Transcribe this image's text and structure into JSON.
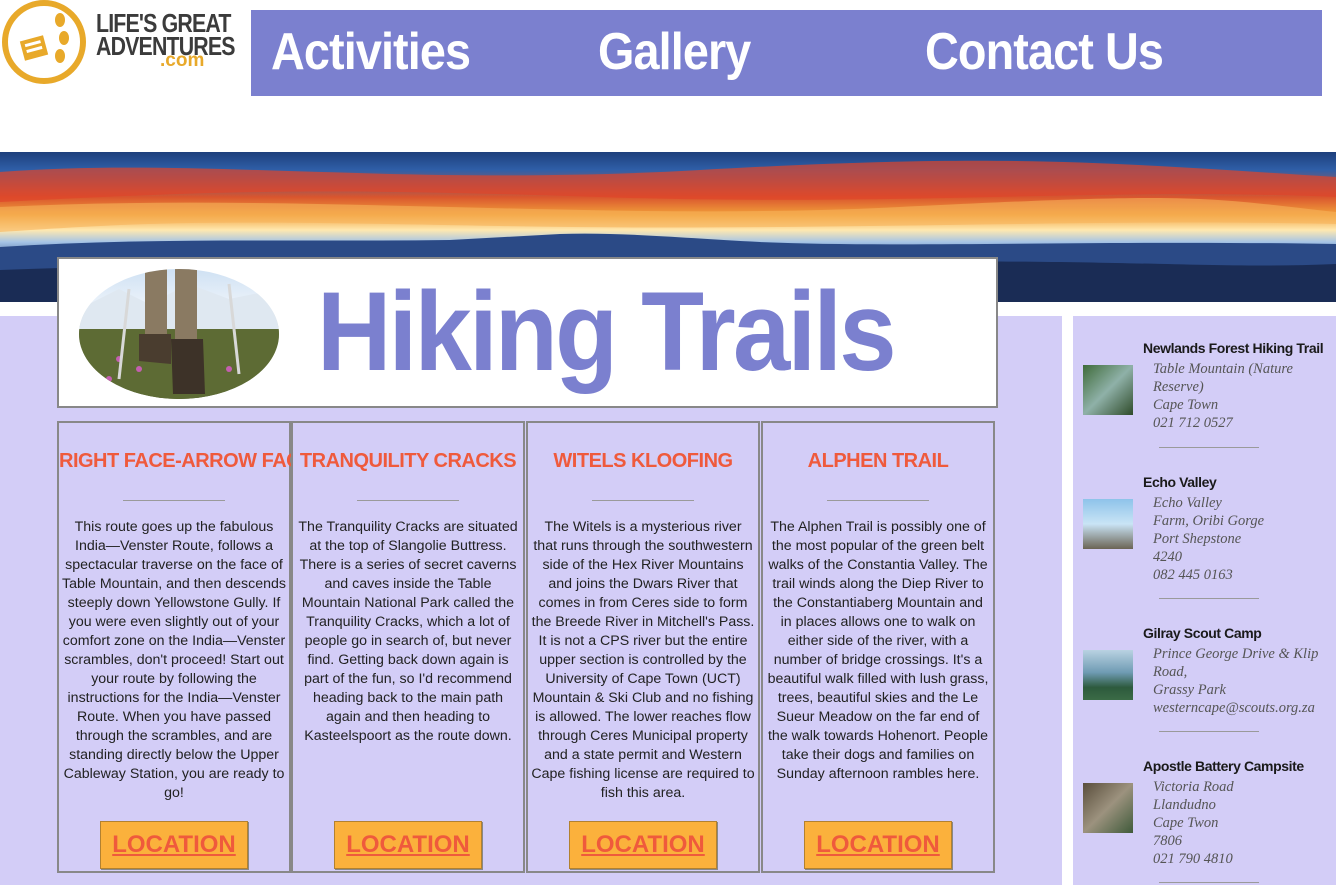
{
  "logo": {
    "line1": "LIFE'S GREAT",
    "line2": "ADVENTURES",
    "dotcom": ".com"
  },
  "nav": [
    {
      "label": "Activities"
    },
    {
      "label": "Gallery"
    },
    {
      "label": "Contact Us"
    }
  ],
  "page_title": "Hiking Trails",
  "cards": [
    {
      "title": "RIGHT FACE-ARROW FACE",
      "text": "This route goes up the fabulous India—Venster Route, follows a spectacular traverse on the face of Table Mountain, and then descends steeply down Yellowstone Gully. If you were even slightly out of your comfort zone on the India—Venster scrambles, don't proceed! Start out your route by following the instructions for the India—Venster Route. When you have passed through the scrambles, and are standing directly below the Upper Cableway Station, you are ready to go!",
      "button": "LOCATION"
    },
    {
      "title": "TRANQUILITY CRACKS",
      "text": "The Tranquility Cracks are situated at the top of Slangolie Buttress. There is a series of secret caverns and caves inside the Table Mountain National Park called the Tranquility Cracks, which a lot of people go in search of, but never find. Getting back down again is part of the fun, so I'd recommend heading back to the main path again and then heading to Kasteelspoort as the route down.",
      "button": "LOCATION"
    },
    {
      "title": "WITELS KLOOFING",
      "text": "The Witels is a mysterious river that runs through the southwestern side of the Hex River Mountains and joins the Dwars River that comes in from Ceres side to form the Breede River in Mitchell's Pass. It is not a CPS river but the entire upper section is controlled by the University of Cape Town (UCT) Mountain & Ski Club and no fishing is allowed. The lower reaches flow through Ceres Municipal property and a state permit and Western Cape fishing license are required to fish this area.",
      "button": "LOCATION"
    },
    {
      "title": "ALPHEN TRAIL",
      "text": "The Alphen Trail is possibly one of the most popular of the green belt walks of the Constantia Valley. The trail winds along the Diep River to the Constantiaberg Mountain and in places allows one to walk on either side of the river, with a number of bridge crossings. It's a beautiful walk filled with lush grass, trees, beautiful skies and the Le Sueur Meadow on the far end of the walk towards Hohenort. People take their dogs and families on Sunday afternoon rambles here.",
      "button": "LOCATION"
    }
  ],
  "sidebar": [
    {
      "title": "Newlands Forest Hiking Trail",
      "lines": [
        "Table Mountain (Nature Reserve)",
        "Cape Town",
        "021 712 0527"
      ]
    },
    {
      "title": "Echo Valley",
      "lines": [
        "Echo Valley",
        "Farm, Oribi Gorge",
        "Port Shepstone",
        "4240",
        "082 445 0163"
      ]
    },
    {
      "title": "Gilray Scout Camp",
      "lines": [
        "Prince George Drive & Klip Road,",
        "Grassy Park",
        "westerncape@scouts.org.za"
      ]
    },
    {
      "title": "Apostle Battery Campsite",
      "lines": [
        "Victoria Road",
        "Llandudno",
        "Cape Twon",
        "7806",
        "021 790 4810"
      ]
    }
  ],
  "colors": {
    "nav_bg": "#7b80cf",
    "panel_bg": "#d3cdf7",
    "card_title": "#ef5a3c",
    "button_bg": "#fbb13c",
    "logo_gold": "#e8a92a"
  }
}
